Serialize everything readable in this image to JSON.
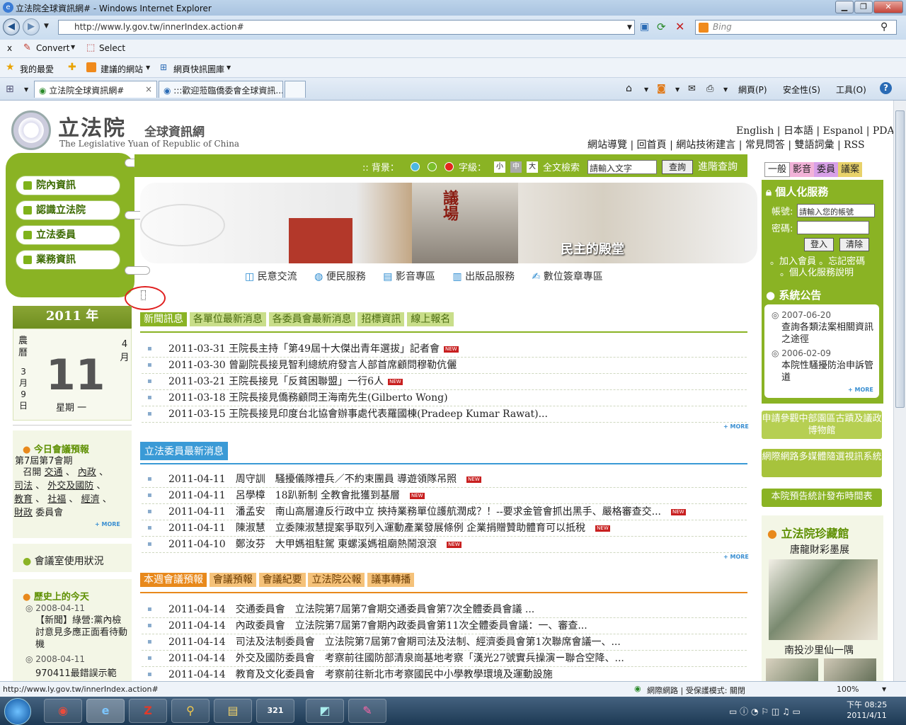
{
  "window": {
    "title": "立法院全球資訊網# - Windows Internet Explorer"
  },
  "address": {
    "url": "http://www.ly.gov.tw/innerIndex.action#",
    "search_placeholder": "Bing"
  },
  "toolbar2": {
    "close": "x",
    "convert": "Convert",
    "select": "Select"
  },
  "favbar": {
    "favorites": "我的最愛",
    "suggested": "建議的網站",
    "gallery": "網頁快訊圖庫"
  },
  "tabs": [
    {
      "label": "立法院全球資訊網#",
      "close": "×"
    },
    {
      "label": ":::歡迎蒞臨僑委會全球資訊..."
    }
  ],
  "cmdbar": {
    "page": "網頁(P)",
    "safety": "安全性(S)",
    "tools": "工具(O)"
  },
  "site": {
    "logo_cn": "立法院",
    "logo_sub": "全球資訊網",
    "logo_en": "The Legislative Yuan of Republic of China",
    "lang_links": [
      "English",
      "日本語",
      "Espanol",
      "PDA"
    ],
    "top_links": [
      "網站導覽",
      "回首頁",
      "網站技術建言",
      "常見問答",
      "雙語詞彙",
      "RSS"
    ],
    "side_menu": [
      "院內資訊",
      "認識立法院",
      "立法委員",
      "業務資訊"
    ],
    "toolbar": {
      "bg_label": ":: 背景：",
      "font_label": "字級：",
      "font_small": "小",
      "font_mid": "中",
      "font_large": "大",
      "search_label": "全文檢索",
      "search_placeholder": "請輸入文字",
      "search_btn": "查詢",
      "advanced": "進階查詢"
    },
    "banner": {
      "caption": "民主的殿堂",
      "sign": "議場"
    },
    "quick": [
      "民意交流",
      "便民服務",
      "影音專區",
      "出版品服務",
      "數位簽章專區"
    ],
    "mode_tabs": [
      "一般",
      "影音",
      "委員",
      "議案"
    ],
    "calendar": {
      "year": "2011 年",
      "month_label": "4 月",
      "day": "11",
      "weekday": "星期 一",
      "lunar_l1": "農",
      "lunar_l2": "曆",
      "lunar_m": "3",
      "lunar_m_u": "月",
      "lunar_d": "9",
      "lunar_d_u": "日"
    },
    "today_meet": {
      "title": "今日會議預報",
      "session": "第7屆第7會期",
      "convene": "召開",
      "committees": [
        "交通",
        "內政",
        "司法",
        "外交及國防",
        "教育",
        "社福",
        "經濟",
        "財政"
      ],
      "tail": "委員會",
      "more": "+ MORE"
    },
    "room": "會議室使用狀況",
    "history": {
      "title": "歷史上的今天",
      "items": [
        {
          "date": "2008-04-11",
          "text": "【新聞】綠營:黨內檢討意見多應正面看待動機"
        },
        {
          "date": "2008-04-11",
          "text": "970411最錯誤示範"
        }
      ]
    },
    "news_tabs": [
      "新聞訊息",
      "各單位最新消息",
      "各委員會最新消息",
      "招標資訊",
      "線上報名"
    ],
    "news": [
      {
        "date": "2011-03-31",
        "text": "王院長主持「第49屆十大傑出青年選拔」記者會",
        "new": true
      },
      {
        "date": "2011-03-30",
        "text": "曾副院長接見智利總統府發言人部首席顧問穆勒伉儷",
        "new": false
      },
      {
        "date": "2011-03-21",
        "text": "王院長接見「反貧困聯盟」一行6人",
        "new": true
      },
      {
        "date": "2011-03-18",
        "text": "王院長接見僑務顧問王海南先生(Gilberto Wong)",
        "new": false
      },
      {
        "date": "2011-03-15",
        "text": "王院長接見印度台北協會辦事處代表羅國棟(Pradeep Kumar Rawat)...",
        "new": false
      }
    ],
    "news_more": "+ MORE",
    "member_title": "立法委員最新消息",
    "member_news": [
      {
        "date": "2011-04-11",
        "name": "周守訓",
        "text": "騷擾儀隊禮兵／不約束團員 導遊領隊吊照",
        "new": true
      },
      {
        "date": "2011-04-11",
        "name": "呂學樟",
        "text": "18趴新制 全教會批獲到基層",
        "new": true
      },
      {
        "date": "2011-04-11",
        "name": "潘孟安",
        "text": "南山高層違反行政中立 挾持業務單位護航潤成？！--要求金管會抓出黑手、嚴格審查交...",
        "new": true
      },
      {
        "date": "2011-04-11",
        "name": "陳淑慧",
        "text": "立委陳淑慧提案爭取列入運動產業發展條例 企業捐贈贊助體育可以抵稅",
        "new": true
      },
      {
        "date": "2011-04-10",
        "name": "鄭汝芬",
        "text": "大甲媽祖駐駕 東螺溪媽祖廟熱鬧滾滾",
        "new": true
      }
    ],
    "member_more": "+ MORE",
    "meet_tabs": [
      "本週會議預報",
      "會議預報",
      "會議紀要",
      "立法院公報",
      "議事轉播"
    ],
    "meetings": [
      {
        "date": "2011-04-14",
        "org": "交通委員會",
        "text": "立法院第7屆第7會期交通委員會第7次全體委員會議 ..."
      },
      {
        "date": "2011-04-14",
        "org": "內政委員會",
        "text": "立法院第7屆第7會期內政委員會第11次全體委員會議：一、審查..."
      },
      {
        "date": "2011-04-14",
        "org": "司法及法制委員會",
        "text": "立法院第7屆第7會期司法及法制、經濟委員會第1次聯席會議一、..."
      },
      {
        "date": "2011-04-14",
        "org": "外交及國防委員會",
        "text": "考察前往國防部清泉崗基地考察「漢光27號實兵操演ー聯合空降、..."
      },
      {
        "date": "2011-04-14",
        "org": "教育及文化委員會",
        "text": "考察前往新北市考察國民中小學教學環境及運動設施"
      }
    ],
    "personal": {
      "title": "個人化服務",
      "account": "帳號:",
      "account_ph": "請輸入您的帳號",
      "password": "密碼:",
      "login": "登入",
      "clear": "清除",
      "join": "。加入會員",
      "forgot": "。忘記密碼",
      "explain": "。個人化服務說明"
    },
    "notice": {
      "title": "系統公告",
      "items": [
        {
          "date": "2007-06-20",
          "text": "查詢各類法案相關資訊之途徑"
        },
        {
          "date": "2006-02-09",
          "text": "本院性騷擾防治申訴管道"
        }
      ],
      "more": "+ MORE"
    },
    "right_btns": [
      "申請參觀中部園區古蹟及議政博物館",
      "網際網路多媒體隨選視訊系統",
      "本院預告統計發布時間表"
    ],
    "treasure": {
      "title": "立法院珍藏館",
      "sub": "唐龍財彩墨展",
      "caption": "南投沙里仙一隅"
    }
  },
  "status": {
    "url": "http://www.ly.gov.tw/innerIndex.action#",
    "zone": "網際網路 | 受保護模式: 關閉",
    "zoom": "100%"
  },
  "clock": {
    "time": "下午 08:25",
    "date": "2011/4/11"
  },
  "colors": {
    "site_green": "#8ab324",
    "orange": "#e8891c",
    "blue": "#3a9ad6"
  }
}
